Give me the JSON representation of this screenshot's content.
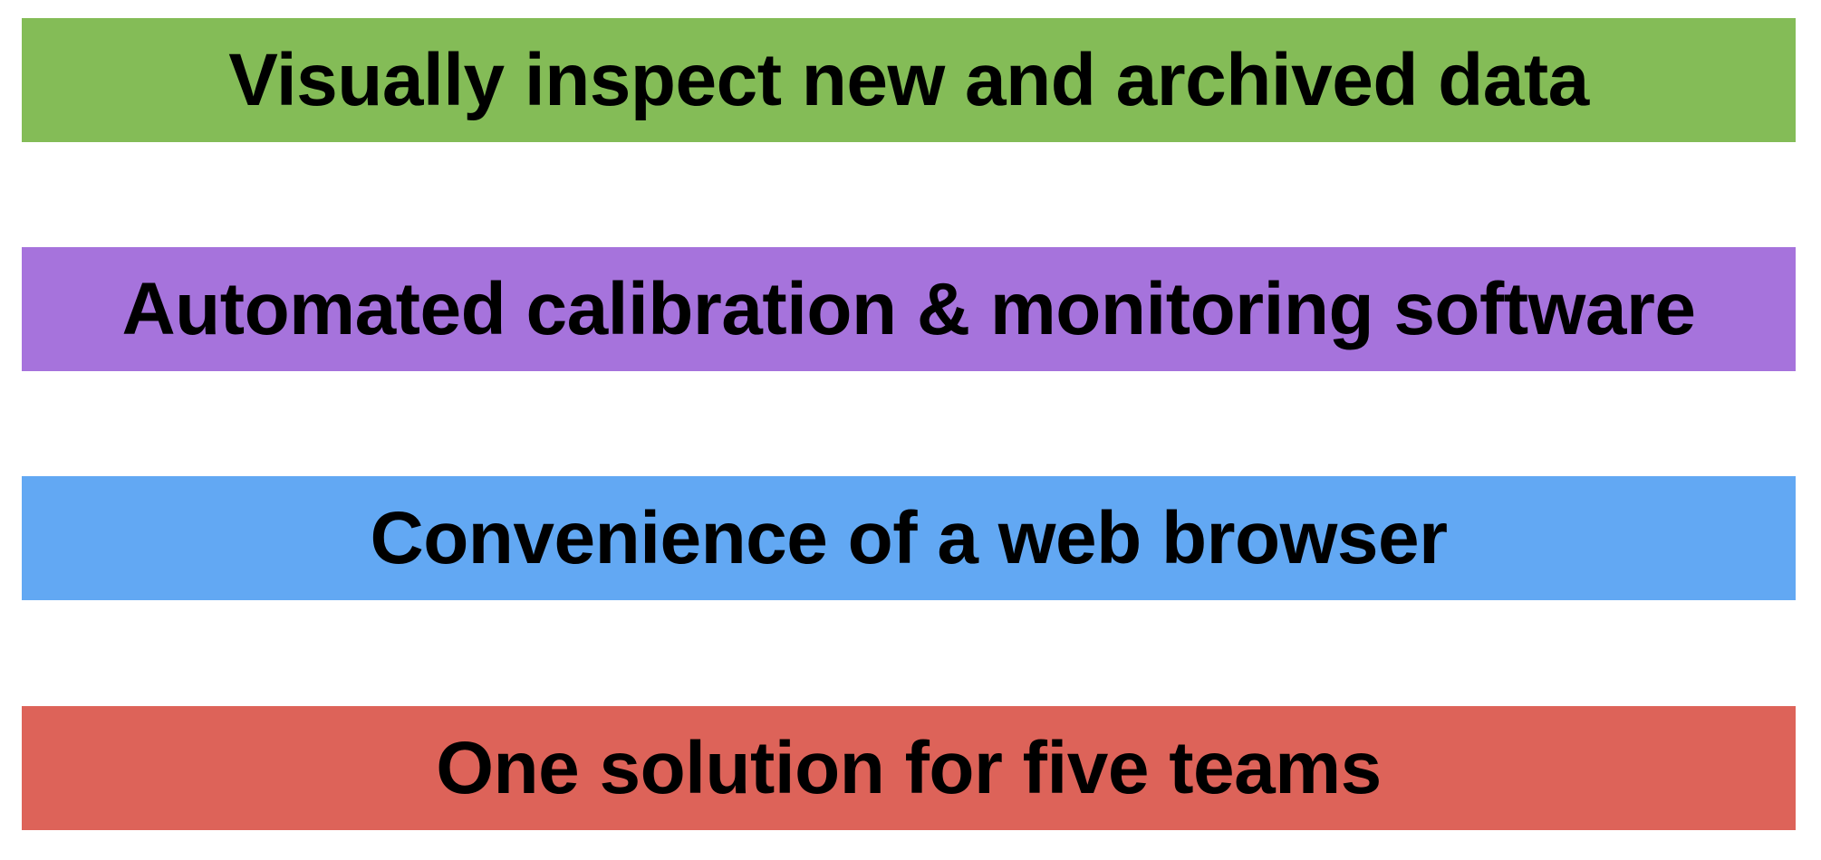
{
  "banners": [
    {
      "text": "Visually inspect new and archived data",
      "color": "#84bc57"
    },
    {
      "text": "Automated calibration & monitoring software",
      "color": "#a673dc"
    },
    {
      "text": "Convenience of a web browser",
      "color": "#62a8f3"
    },
    {
      "text": "One solution for five teams",
      "color": "#dd6359"
    }
  ]
}
